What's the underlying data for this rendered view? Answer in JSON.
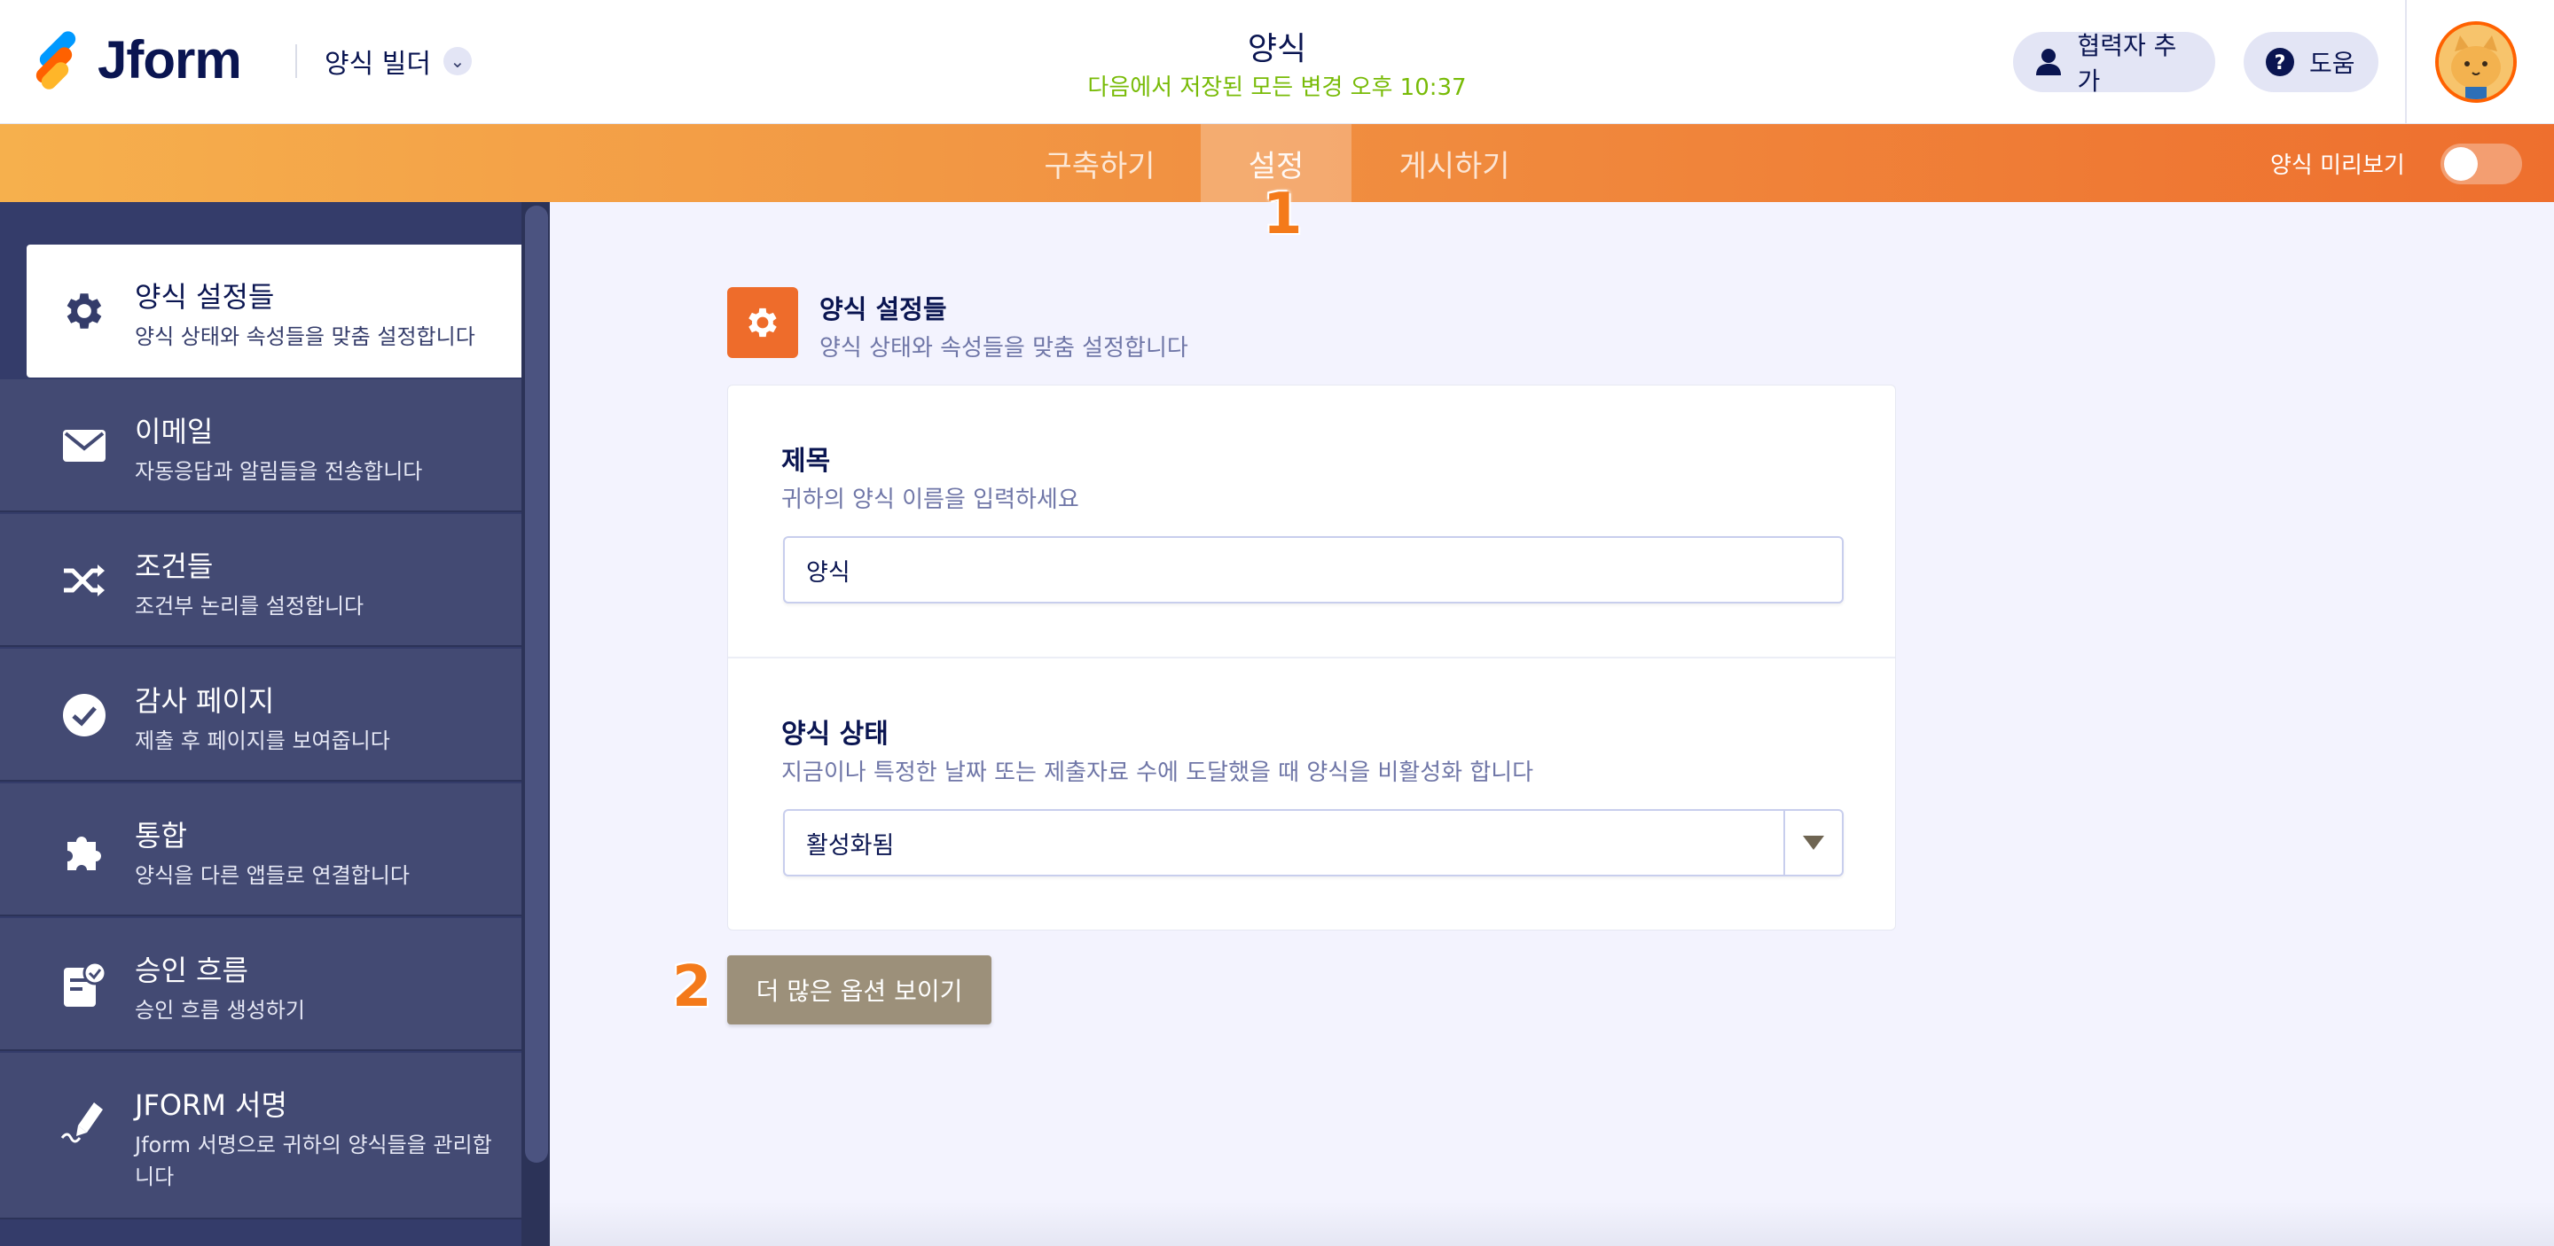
{
  "header": {
    "logo_text": "Jform",
    "builder_label": "양식 빌더",
    "form_title": "양식",
    "save_status": "다음에서 저장된 모든 변경 오후 10:37",
    "collaborator_label": "협력자 추가",
    "help_label": "도움"
  },
  "nav": {
    "tabs": [
      {
        "label": "구축하기",
        "active": false
      },
      {
        "label": "설정",
        "active": true
      },
      {
        "label": "게시하기",
        "active": false
      }
    ],
    "preview_label": "양식 미리보기",
    "preview_on": false
  },
  "annotations": {
    "one": "1",
    "two": "2"
  },
  "sidebar": {
    "items": [
      {
        "title": "양식 설정들",
        "desc": "양식 상태와 속성들을 맞춤 설정합니다",
        "icon": "gear-icon",
        "active": true
      },
      {
        "title": "이메일",
        "desc": "자동응답과 알림들을 전송합니다",
        "icon": "envelope-icon"
      },
      {
        "title": "조건들",
        "desc": "조건부 논리를 설정합니다",
        "icon": "shuffle-icon"
      },
      {
        "title": "감사 페이지",
        "desc": "제출 후 페이지를 보여줍니다",
        "icon": "check-circle-icon"
      },
      {
        "title": "통합",
        "desc": "양식을 다른 앱들로 연결합니다",
        "icon": "puzzle-icon"
      },
      {
        "title": "승인 흐름",
        "desc": "승인 흐름 생성하기",
        "icon": "approval-icon"
      },
      {
        "title": "JFORM 서명",
        "desc": "Jform 서명으로 귀하의 양식들을 관리합니다",
        "icon": "signature-pen-icon"
      }
    ]
  },
  "main": {
    "section_title": "양식 설정들",
    "section_desc": "양식 상태와 속성들을 맞춤 설정합니다",
    "title_field": {
      "label": "제목",
      "help": "귀하의 양식 이름을 입력하세요",
      "value": "양식"
    },
    "status_field": {
      "label": "양식 상태",
      "help": "지금이나 특정한 날짜 또는 제출자료 수에 도달했을 때 양식을 비활성화 합니다",
      "value": "활성화됨"
    },
    "more_options_label": "더 많은 옵션 보이기"
  },
  "colors": {
    "accent_orange": "#ee6c2b",
    "sidebar_bg": "#343c6a",
    "save_green": "#78bb07",
    "more_button": "#9c907a"
  }
}
